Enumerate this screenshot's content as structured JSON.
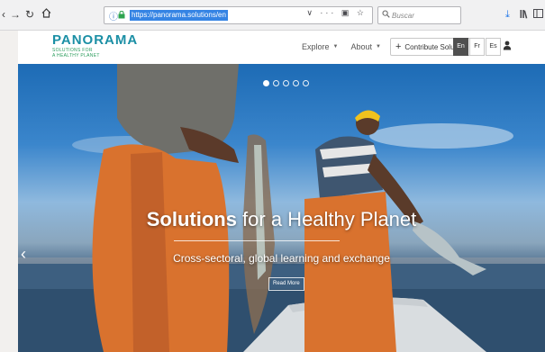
{
  "browser": {
    "url": "https://panorama.solutions/en",
    "search_placeholder": "Buscar",
    "url_tools": "∨ ··· ▣ ☆"
  },
  "site": {
    "logo_word": "PANORAMA",
    "logo_tagline_1": "SOLUTIONS FOR",
    "logo_tagline_2": "A HEALTHY PLANET",
    "menu": {
      "explore": "Explore",
      "about": "About",
      "contribute": "Contribute Solution"
    },
    "languages": [
      "En",
      "Fr",
      "Es"
    ],
    "active_language": "En"
  },
  "hero": {
    "headline_strong": "Solutions",
    "headline_rest": " for a Healthy Planet",
    "subtitle": "Cross-sectoral, global learning and exchange",
    "button": "Read More",
    "slide_count": 5,
    "active_slide": 1
  },
  "icons": [
    "back-icon",
    "forward-icon",
    "reload-icon",
    "home-icon",
    "info-icon",
    "lock-icon",
    "search-icon",
    "download-icon",
    "library-icon",
    "sidebar-icon",
    "user-icon",
    "prev-arrow-icon"
  ]
}
